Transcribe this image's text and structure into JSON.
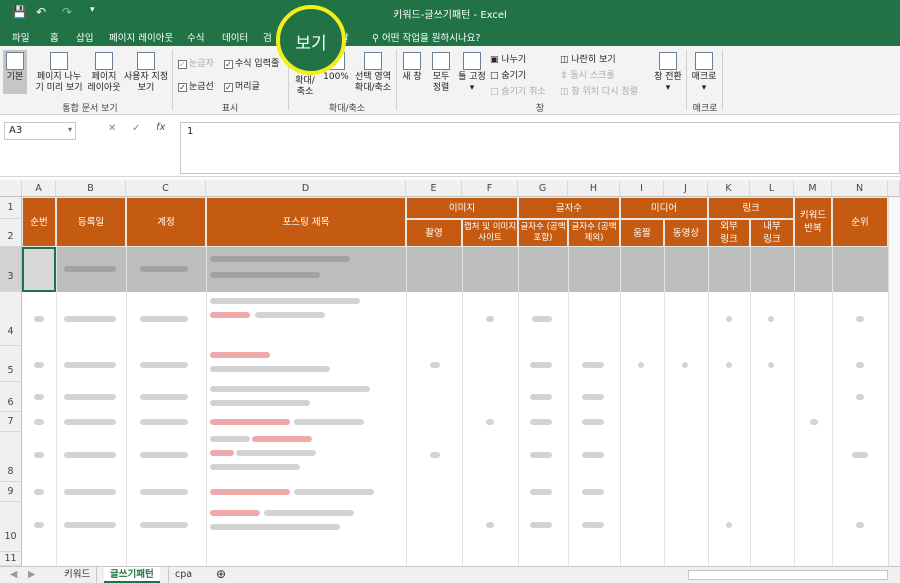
{
  "title": "키워드-글쓰기패턴  -  Excel",
  "tabs": [
    "파일",
    "홈",
    "삽입",
    "페이지 레이아웃",
    "수식",
    "데이터",
    "검",
    "보기",
    "말"
  ],
  "tell_me": "어떤 작업을 원하시나요?",
  "highlighted_tab": "보기",
  "ribbon": {
    "views": [
      "기본",
      "페이지 나누기 미리 보기",
      "페이지 레이아웃",
      "사용자 지정 보기"
    ],
    "views_line1": [
      "기본",
      "페이지 나누",
      "페이지",
      "사용자 지정"
    ],
    "views_line2": [
      "",
      "기 미리 보기",
      "레이아웃",
      "보기"
    ],
    "group_views": "통합 문서 보기",
    "show_checks": [
      {
        "label": "눈금자",
        "checked": true,
        "disabled": true
      },
      {
        "label": "수식 입력줄",
        "checked": true,
        "disabled": false
      },
      {
        "label": "눈금선",
        "checked": true,
        "disabled": false
      },
      {
        "label": "머리글",
        "checked": true,
        "disabled": false
      }
    ],
    "group_show": "표시",
    "zoom_btn": "확대/축소",
    "zoom_btn_l1": "확대/",
    "zoom_btn_l2": "축소",
    "zoom100": "100%",
    "zoom_sel_l1": "선택 영역",
    "zoom_sel_l2": "확대/축소",
    "group_zoom": "확대/축소",
    "new_window": "새 창",
    "arrange_l1": "모두",
    "arrange_l2": "정렬",
    "freeze": "틀 고정",
    "split": "나누기",
    "hide": "숨기기",
    "unhide": "숨기기 취소",
    "side_by_side": "나란히 보기",
    "sync_scroll": "동시 스크롤",
    "reset_pos": "창 위치 다시 정렬",
    "switch": "창 전환",
    "group_window": "창",
    "macro": "매크로",
    "group_macro": "매크로"
  },
  "namebox": "A3",
  "formula": "1",
  "columns": [
    "A",
    "B",
    "C",
    "D",
    "E",
    "F",
    "G",
    "H",
    "I",
    "J",
    "K",
    "L",
    "M",
    "N"
  ],
  "rows": [
    "1",
    "2",
    "3",
    "4",
    "5",
    "6",
    "7",
    "8",
    "9",
    "10",
    "11"
  ],
  "header": {
    "a": "순번",
    "b": "등록일",
    "c": "계정",
    "d": "포스팅 제목",
    "image": "이미지",
    "chars": "글자수",
    "media": "미디어",
    "link": "링크",
    "m": "키워드 반복",
    "n": "순위",
    "e2": "촬영",
    "f2": "캡처 및 이미지사이트",
    "g2": "글자수 (공백포함)",
    "h2": "글자수 (공백제외)",
    "i2": "움짤",
    "j2": "동영상",
    "k2": "외부 링크",
    "l2": "내부 링크"
  },
  "sheets": [
    "키워드",
    "글쓰기패턴",
    "cpa"
  ],
  "active_sheet": "글쓰기패턴"
}
